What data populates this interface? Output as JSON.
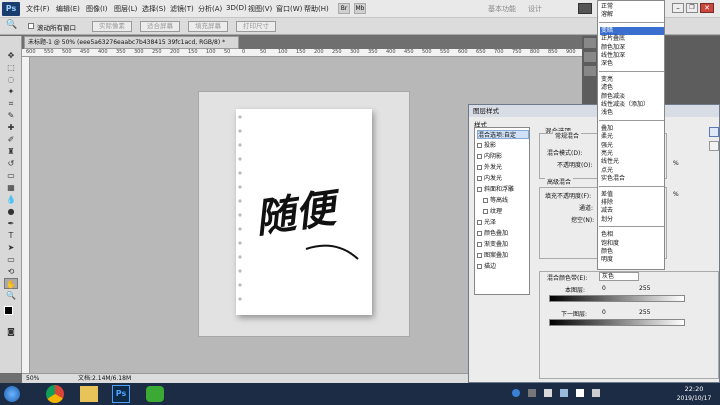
{
  "menubar": {
    "logo": "Ps",
    "items": [
      "文件(F)",
      "编辑(E)",
      "图像(I)",
      "图层(L)",
      "选择(S)",
      "滤镜(T)",
      "分析(A)",
      "3D(D)",
      "视图(V)",
      "窗口(W)",
      "帮助(H)"
    ],
    "workspace": [
      "基本功能",
      "设计"
    ]
  },
  "optbar": {
    "scroll_all": "滚动所有窗口",
    "buttons": [
      "实际像素",
      "适合屏幕",
      "填充屏幕",
      "打印尺寸"
    ]
  },
  "document": {
    "tab": "未标题-1 @ 50% (eee5a63276eaabc7b438415 39fc1acd, RGB/8) *",
    "zoom": "50%",
    "doc_size": "文档:2.14M/6.18M",
    "calligraphy": "随便"
  },
  "ruler": [
    "600",
    "550",
    "500",
    "450",
    "400",
    "350",
    "300",
    "250",
    "200",
    "150",
    "100",
    "50",
    "0",
    "50",
    "100",
    "150",
    "200",
    "250",
    "300",
    "350",
    "400",
    "450",
    "500",
    "550",
    "600",
    "650",
    "700",
    "750",
    "800",
    "850",
    "900",
    "950"
  ],
  "dialog": {
    "title": "图层样式",
    "styles_header": "样式",
    "styles": [
      {
        "label": "混合选项:自定",
        "checkbox": false,
        "selected": true
      },
      {
        "label": "投影",
        "checkbox": true
      },
      {
        "label": "内阴影",
        "checkbox": true
      },
      {
        "label": "外发光",
        "checkbox": true
      },
      {
        "label": "内发光",
        "checkbox": true
      },
      {
        "label": "斜面和浮雕",
        "checkbox": true
      },
      {
        "label": "等高线",
        "checkbox": true,
        "indent": true
      },
      {
        "label": "纹理",
        "checkbox": true,
        "indent": true
      },
      {
        "label": "光泽",
        "checkbox": true
      },
      {
        "label": "颜色叠加",
        "checkbox": true
      },
      {
        "label": "渐变叠加",
        "checkbox": true
      },
      {
        "label": "图案叠加",
        "checkbox": true
      },
      {
        "label": "描边",
        "checkbox": true
      }
    ],
    "blend_options": "混合选项",
    "general_blend": "常规混合",
    "blend_mode_label": "混合模式(D):",
    "opacity_label": "不透明度(O):",
    "advanced_blend": "高级混合",
    "fill_opacity_label": "填充不透明度(F):",
    "channels_label": "通道:",
    "knockout_label": "挖空(N):",
    "blend_if_label": "混合颜色带(E):",
    "blend_if_value": "灰色",
    "this_layer": "本图层:",
    "this_layer_min": "0",
    "this_layer_max": "255",
    "under_layer": "下一图层:",
    "under_layer_min": "0",
    "under_layer_max": "255",
    "percent": "%"
  },
  "blend_dropdown": {
    "groups": [
      [
        "正常",
        "溶解"
      ],
      [
        "变暗",
        "正片叠底",
        "颜色加深",
        "线性加深",
        "深色"
      ],
      [
        "变亮",
        "滤色",
        "颜色减淡",
        "线性减淡（添加）",
        "浅色"
      ],
      [
        "叠加",
        "柔光",
        "强光",
        "亮光",
        "线性光",
        "点光",
        "实色混合"
      ],
      [
        "差值",
        "排除",
        "减去",
        "划分"
      ],
      [
        "色相",
        "饱和度",
        "颜色",
        "明度"
      ]
    ],
    "selected": "变暗"
  },
  "taskbar": {
    "time": "22:20",
    "date": "2019/10/17"
  }
}
